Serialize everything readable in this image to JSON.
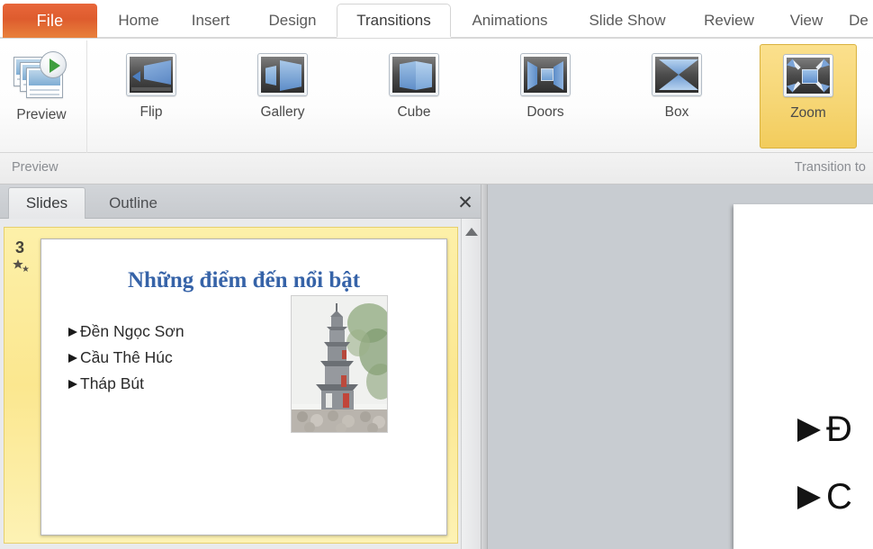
{
  "ribbon_tabs": [
    {
      "label": "File",
      "active": false,
      "kind": "file"
    },
    {
      "label": "Home",
      "active": false
    },
    {
      "label": "Insert",
      "active": false
    },
    {
      "label": "Design",
      "active": false
    },
    {
      "label": "Transitions",
      "active": true
    },
    {
      "label": "Animations",
      "active": false
    },
    {
      "label": "Slide Show",
      "active": false
    },
    {
      "label": "Review",
      "active": false
    },
    {
      "label": "View",
      "active": false
    },
    {
      "label": "De",
      "active": false
    }
  ],
  "preview_group": {
    "button_label": "Preview",
    "group_label": "Preview",
    "icon": "preview-slideshow-play-icon"
  },
  "transition_group": {
    "group_label": "Transition to",
    "items": [
      {
        "label": "Flip",
        "icon": "transition-flip-icon",
        "selected": false
      },
      {
        "label": "Gallery",
        "icon": "transition-gallery-icon",
        "selected": false
      },
      {
        "label": "Cube",
        "icon": "transition-cube-icon",
        "selected": false
      },
      {
        "label": "Doors",
        "icon": "transition-doors-icon",
        "selected": false
      },
      {
        "label": "Box",
        "icon": "transition-box-icon",
        "selected": false
      },
      {
        "label": "Zoom",
        "icon": "transition-zoom-icon",
        "selected": true
      }
    ]
  },
  "slides_panel": {
    "tabs": [
      {
        "label": "Slides",
        "active": true
      },
      {
        "label": "Outline",
        "active": false
      }
    ],
    "close_icon": "close-icon",
    "scroll_up_icon": "scroll-up-arrow-icon",
    "thumbnail": {
      "number": "3",
      "transition_badge_icon": "transition-star-icon",
      "title": "Những điểm đến nổi bật",
      "bullets": [
        "Đền Ngọc Sơn",
        "Cầu Thê Húc",
        "Tháp Bút"
      ],
      "image_alt": "pagoda-photo"
    }
  },
  "main_slide": {
    "bullets": [
      "Đ",
      "C"
    ]
  },
  "colors": {
    "file_tab": "#e2642f",
    "selected_transition": "#f6d675",
    "slide_title": "#3663a8",
    "thumbnail_selection": "#fbe78f",
    "editor_background": "#c8ccd1"
  }
}
